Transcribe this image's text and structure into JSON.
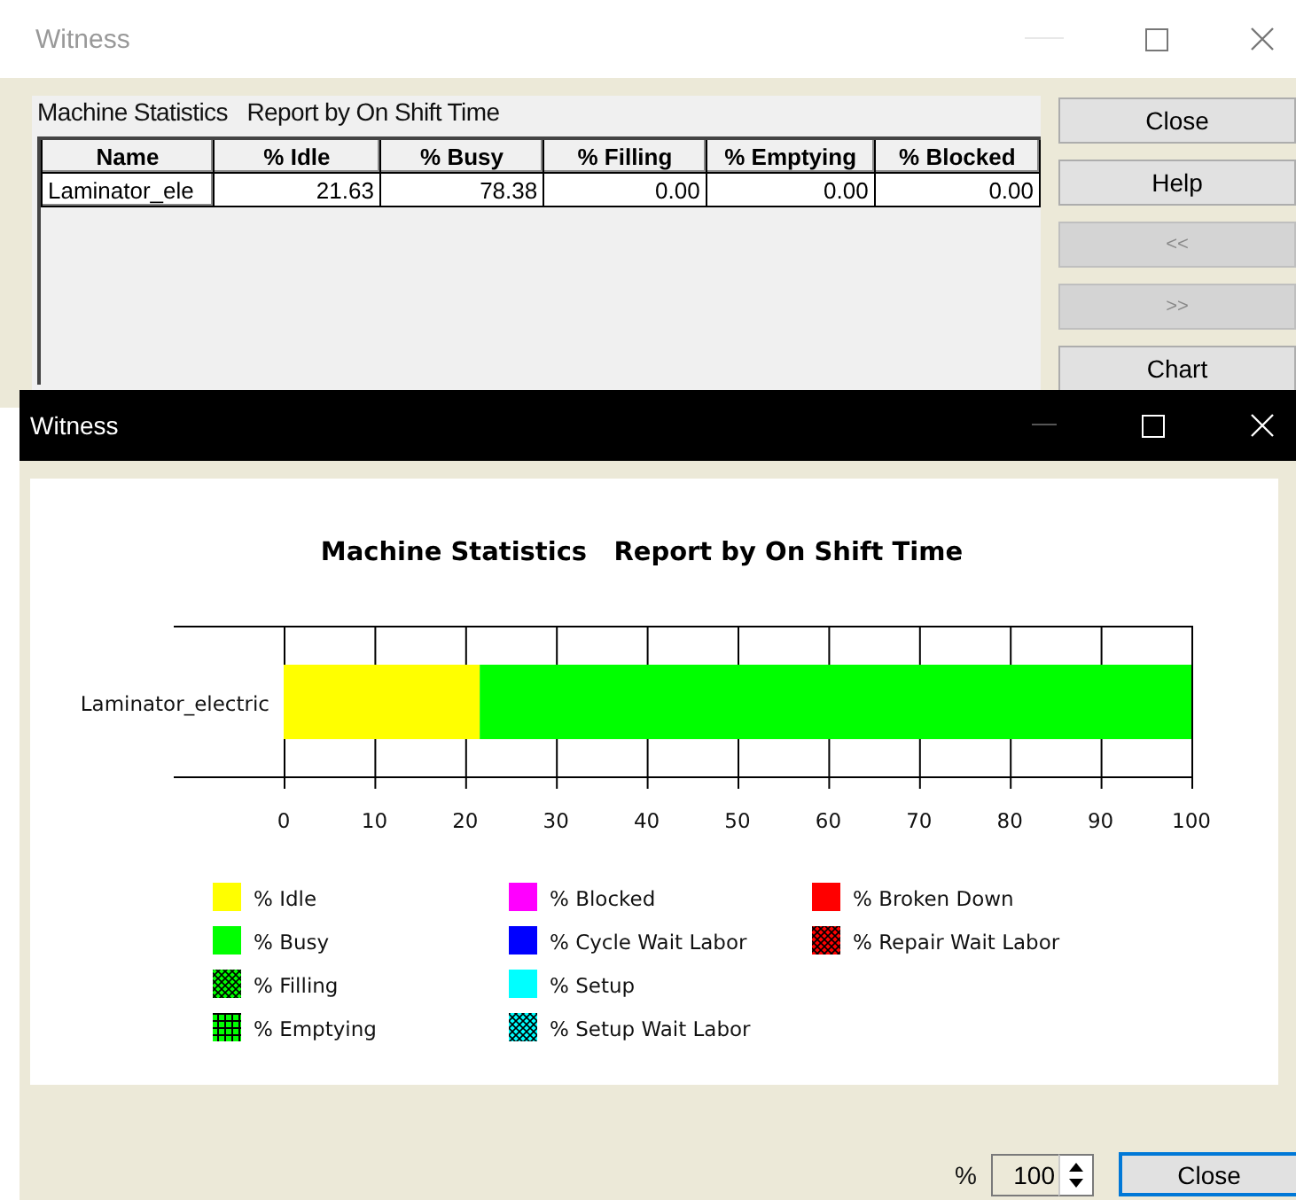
{
  "report_window": {
    "title": "Witness",
    "report_label": "Machine Statistics   Report by On Shift Time",
    "table": {
      "columns": [
        "Name",
        "% Idle",
        "% Busy",
        "% Filling",
        "% Emptying",
        "% Blocked"
      ],
      "rows": [
        {
          "cells": [
            "Laminator_ele",
            "21.63",
            "78.38",
            "0.00",
            "0.00",
            "0.00"
          ]
        }
      ]
    },
    "buttons": [
      {
        "label": "Close",
        "disabled": false
      },
      {
        "label": "Help",
        "disabled": false
      },
      {
        "label": "<<",
        "disabled": true
      },
      {
        "label": ">>",
        "disabled": true
      },
      {
        "label": "Chart",
        "disabled": false
      }
    ]
  },
  "chart_window": {
    "title": "Witness",
    "legend_swatches": [
      {
        "kind": "solid"
      },
      {
        "kind": "solid"
      },
      {
        "kind": "crosshatch"
      },
      {
        "kind": "grid"
      },
      {
        "kind": "solid"
      },
      {
        "kind": "solid"
      },
      {
        "kind": "solid"
      },
      {
        "kind": "crosshatch"
      },
      {
        "kind": "solid"
      },
      {
        "kind": "crosshatch"
      }
    ],
    "chart_data": {
      "type": "bar",
      "orientation": "horizontal",
      "stacked": true,
      "grid": true,
      "legend": true,
      "title": "Machine Statistics   Report by On Shift Time",
      "categories": [
        "Laminator_electric"
      ],
      "xlim": [
        0,
        100
      ],
      "xticks": [
        0,
        10,
        20,
        30,
        40,
        50,
        60,
        70,
        80,
        90,
        100
      ],
      "series": [
        {
          "name": "% Idle",
          "color": "#ffff00",
          "values": [
            21.6
          ]
        },
        {
          "name": "% Busy",
          "color": "#00ff00",
          "values": [
            78.4
          ]
        },
        {
          "name": "% Filling",
          "color": "#00ff00",
          "values": [
            0
          ]
        },
        {
          "name": "% Emptying",
          "color": "#00ff00",
          "values": [
            0
          ]
        },
        {
          "name": "% Blocked",
          "color": "#ff00ff",
          "values": [
            0
          ]
        },
        {
          "name": "% Cycle Wait Labor",
          "color": "#0000ff",
          "values": [
            0
          ]
        },
        {
          "name": "% Setup",
          "color": "#00ffff",
          "values": [
            0
          ]
        },
        {
          "name": "% Setup Wait Labor",
          "color": "#00ffff",
          "values": [
            0
          ]
        },
        {
          "name": "% Broken Down",
          "color": "#ff0000",
          "values": [
            0
          ]
        },
        {
          "name": "% Repair Wait Labor",
          "color": "#ff0000",
          "values": [
            0
          ]
        }
      ]
    },
    "zoom": {
      "label": "%",
      "value": "100"
    },
    "close_button": "Close"
  }
}
